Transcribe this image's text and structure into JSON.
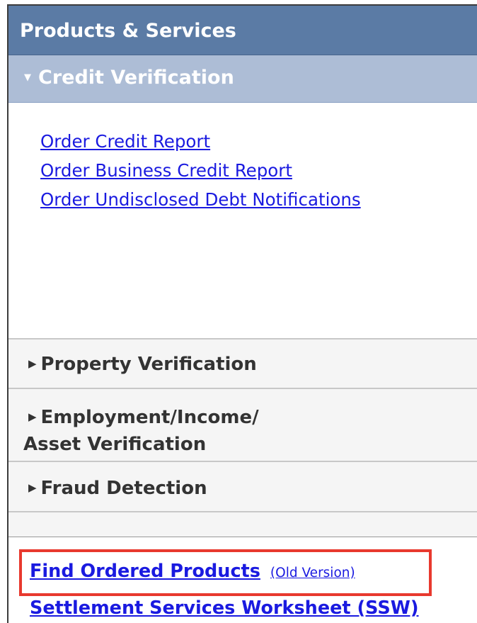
{
  "panel": {
    "title": "Products & Services"
  },
  "credit_section": {
    "label": "Credit Verification",
    "expanded": true,
    "links": [
      "Order Credit Report",
      "Order Business Credit Report",
      "Order Undisclosed Debt Notifications"
    ]
  },
  "sections": {
    "property": "Property Verification",
    "employment_line1": "Employment/Income/",
    "employment_line2": "Asset Verification",
    "fraud": "Fraud Detection"
  },
  "bottom": {
    "find_label": "Find Ordered Products",
    "old_version_label": "(Old Version)",
    "ssw_label": "Settlement Services Worksheet (SSW)"
  },
  "colors": {
    "header_bg": "#5b7ba5",
    "section_open_bg": "#adbdd6",
    "link": "#1a1ae0",
    "highlight": "#e8392e"
  }
}
